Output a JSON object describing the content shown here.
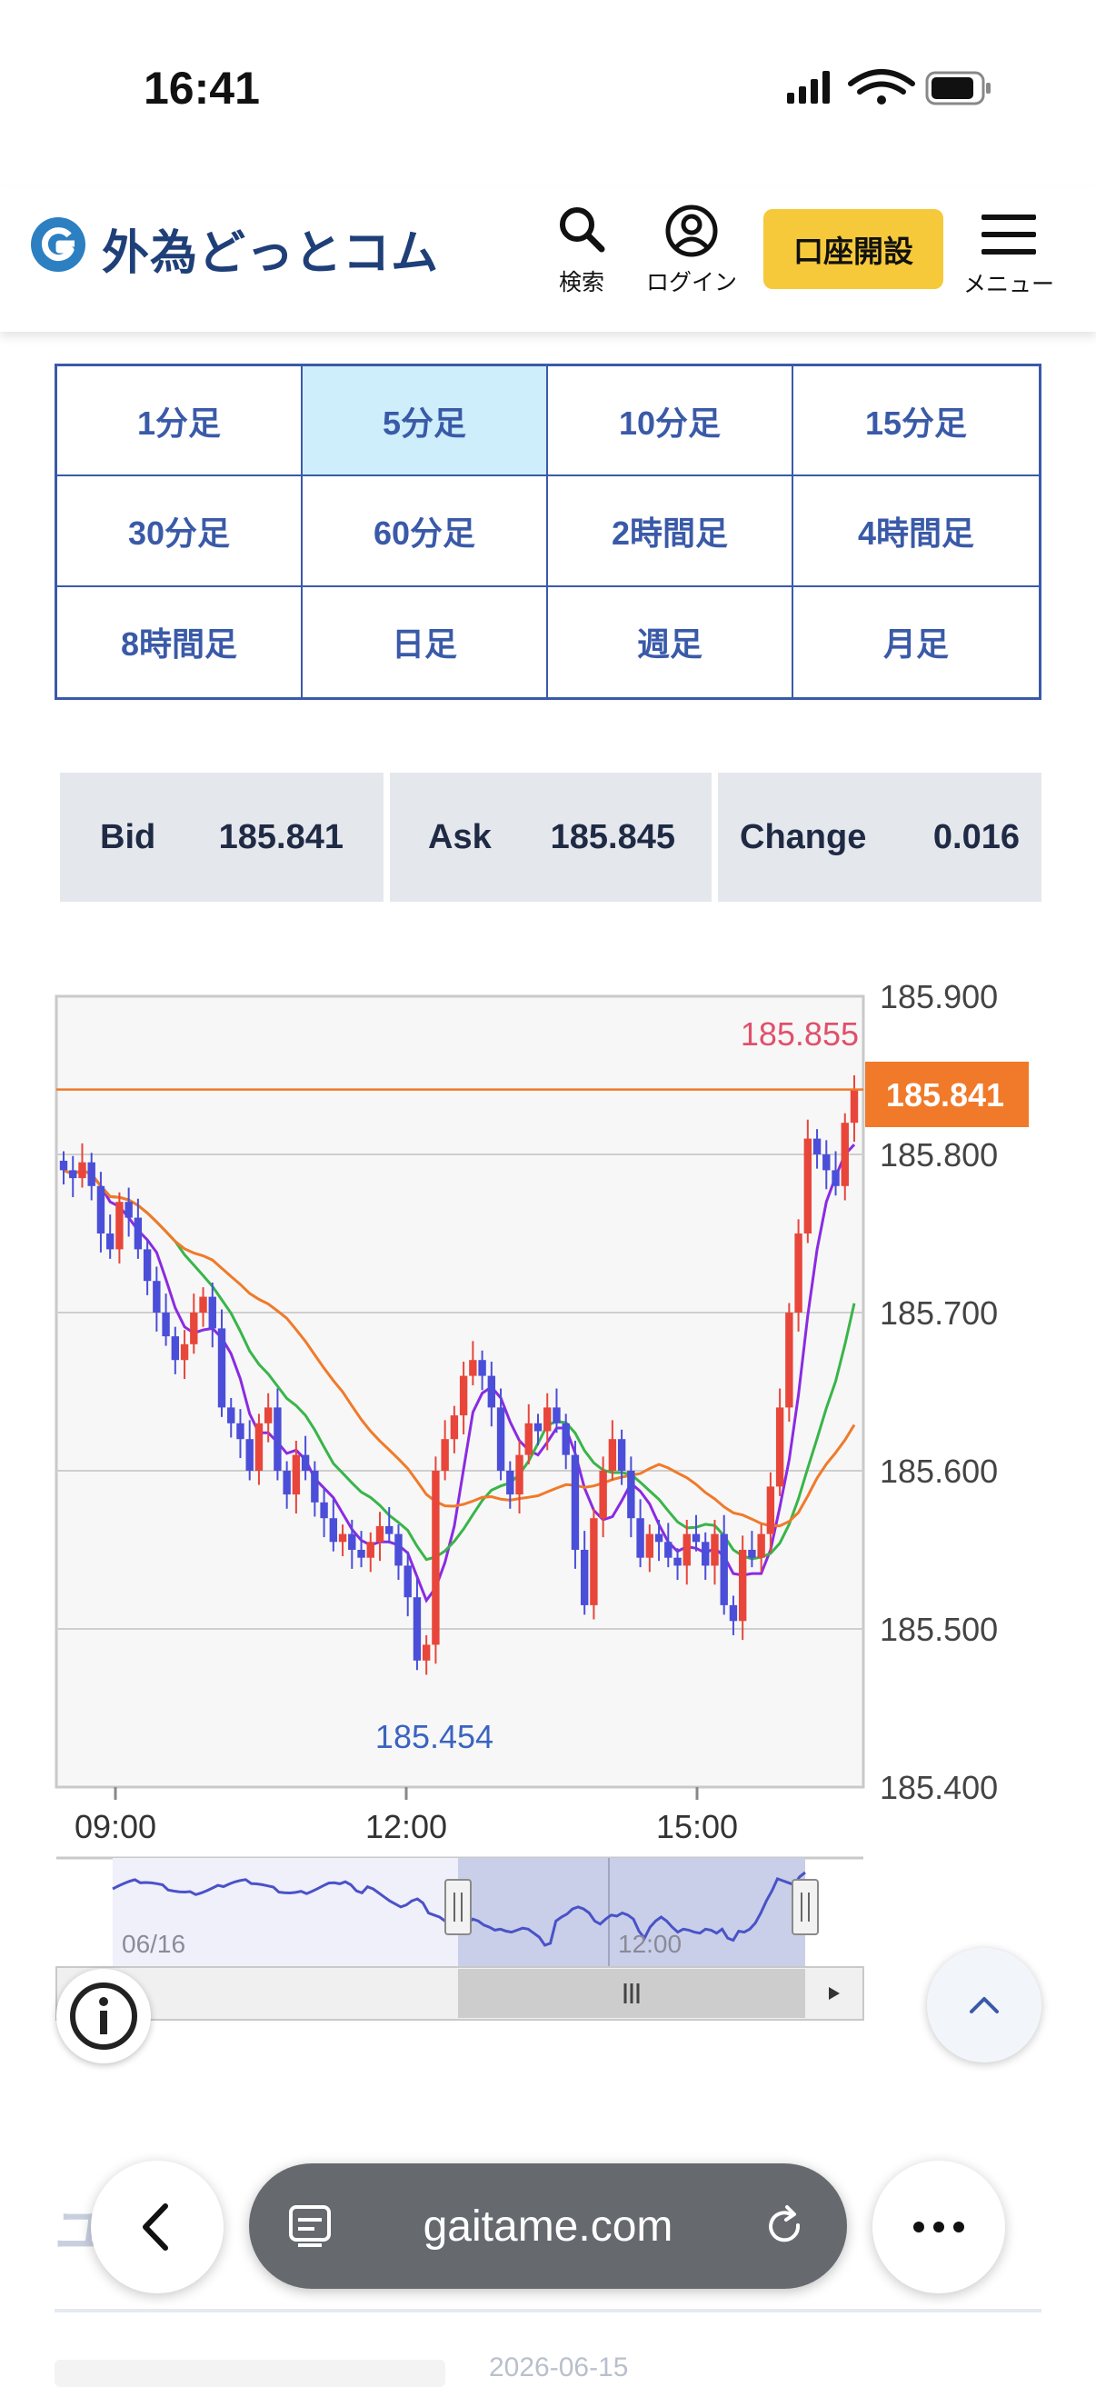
{
  "status_bar": {
    "time": "16:41"
  },
  "header": {
    "logo_text": "外為どっとコム",
    "search_label": "検索",
    "login_label": "ログイン",
    "open_account_label": "口座開設",
    "menu_label": "メニュー"
  },
  "timeframes": [
    {
      "label": "1分足",
      "active": false
    },
    {
      "label": "5分足",
      "active": true
    },
    {
      "label": "10分足",
      "active": false
    },
    {
      "label": "15分足",
      "active": false
    },
    {
      "label": "30分足",
      "active": false
    },
    {
      "label": "60分足",
      "active": false
    },
    {
      "label": "2時間足",
      "active": false
    },
    {
      "label": "4時間足",
      "active": false
    },
    {
      "label": "8時間足",
      "active": false
    },
    {
      "label": "日足",
      "active": false
    },
    {
      "label": "週足",
      "active": false
    },
    {
      "label": "月足",
      "active": false
    }
  ],
  "quote": {
    "bid_label": "Bid",
    "bid_value": "185.841",
    "ask_label": "Ask",
    "ask_value": "185.845",
    "change_label": "Change",
    "change_value": "0.016"
  },
  "chart_data": {
    "type": "candlestick",
    "y_ticks": [
      "185.900",
      "185.800",
      "185.700",
      "185.600",
      "185.500",
      "185.400"
    ],
    "ylim": [
      185.4,
      185.9
    ],
    "x_ticks": [
      "09:00",
      "12:00",
      "15:00"
    ],
    "high_label": "185.855",
    "low_label": "185.454",
    "current_price_label": "185.841",
    "current_price": 185.841,
    "high": 185.855,
    "low": 185.454,
    "colors": {
      "up": "#e8463a",
      "down": "#4b4ed8",
      "ma_fast": "#8a2be2",
      "ma_mid": "#39b54a",
      "ma_slow": "#f07a2a",
      "price_line": "#f07a2a"
    },
    "closes": [
      185.79,
      185.785,
      185.795,
      185.78,
      185.75,
      185.74,
      185.77,
      185.76,
      185.74,
      185.72,
      185.7,
      185.685,
      185.67,
      185.68,
      185.7,
      185.71,
      185.69,
      185.64,
      185.63,
      185.62,
      185.6,
      185.63,
      185.64,
      185.6,
      185.585,
      185.61,
      185.6,
      185.58,
      185.57,
      185.555,
      185.56,
      185.55,
      185.545,
      185.555,
      185.565,
      185.56,
      185.54,
      185.52,
      185.48,
      185.49,
      185.6,
      185.62,
      185.635,
      185.66,
      185.67,
      185.66,
      185.64,
      185.6,
      185.585,
      185.61,
      185.63,
      185.625,
      185.64,
      185.63,
      185.61,
      185.55,
      185.515,
      185.57,
      185.6,
      185.62,
      185.6,
      185.57,
      185.545,
      185.56,
      185.555,
      185.545,
      185.54,
      185.56,
      185.555,
      185.54,
      185.56,
      185.515,
      185.505,
      185.55,
      185.545,
      185.56,
      185.59,
      185.64,
      185.7,
      185.75,
      185.81,
      185.8,
      185.79,
      185.78,
      185.82,
      185.841
    ],
    "navigator": {
      "date_label": "06/16",
      "time_label": "12:00"
    }
  },
  "browser_bar": {
    "url": "gaitame.com",
    "background_text": "ユ /",
    "background_date": "2026-06-15"
  }
}
